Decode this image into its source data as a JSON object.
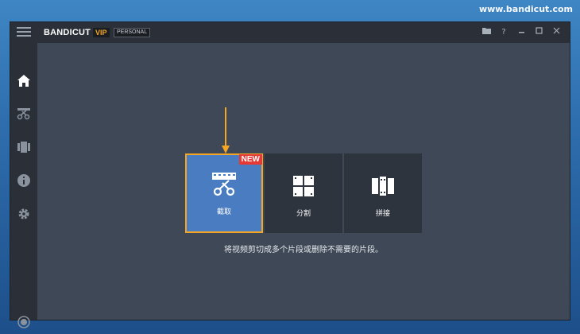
{
  "watermark": "www.bandicut.com",
  "header": {
    "logo": "BANDICUT",
    "vip_label": "VIP",
    "edition_label": "PERSONAL"
  },
  "sidebar": {
    "items": [
      {
        "name": "home-icon"
      },
      {
        "name": "cut-icon"
      },
      {
        "name": "encode-icon"
      },
      {
        "name": "info-icon"
      },
      {
        "name": "settings-icon"
      }
    ]
  },
  "tiles": [
    {
      "label": "截取",
      "icon": "scissors-film-icon",
      "badge": "NEW",
      "selected": true
    },
    {
      "label": "分割",
      "icon": "split-grid-icon",
      "selected": false
    },
    {
      "label": "拼接",
      "icon": "join-film-icon",
      "selected": false
    }
  ],
  "description": "将视频剪切成多个片段或删除不需要的片段。",
  "colors": {
    "accent": "#f5a623",
    "tile_active": "#4a7cc2",
    "badge": "#e53935"
  }
}
